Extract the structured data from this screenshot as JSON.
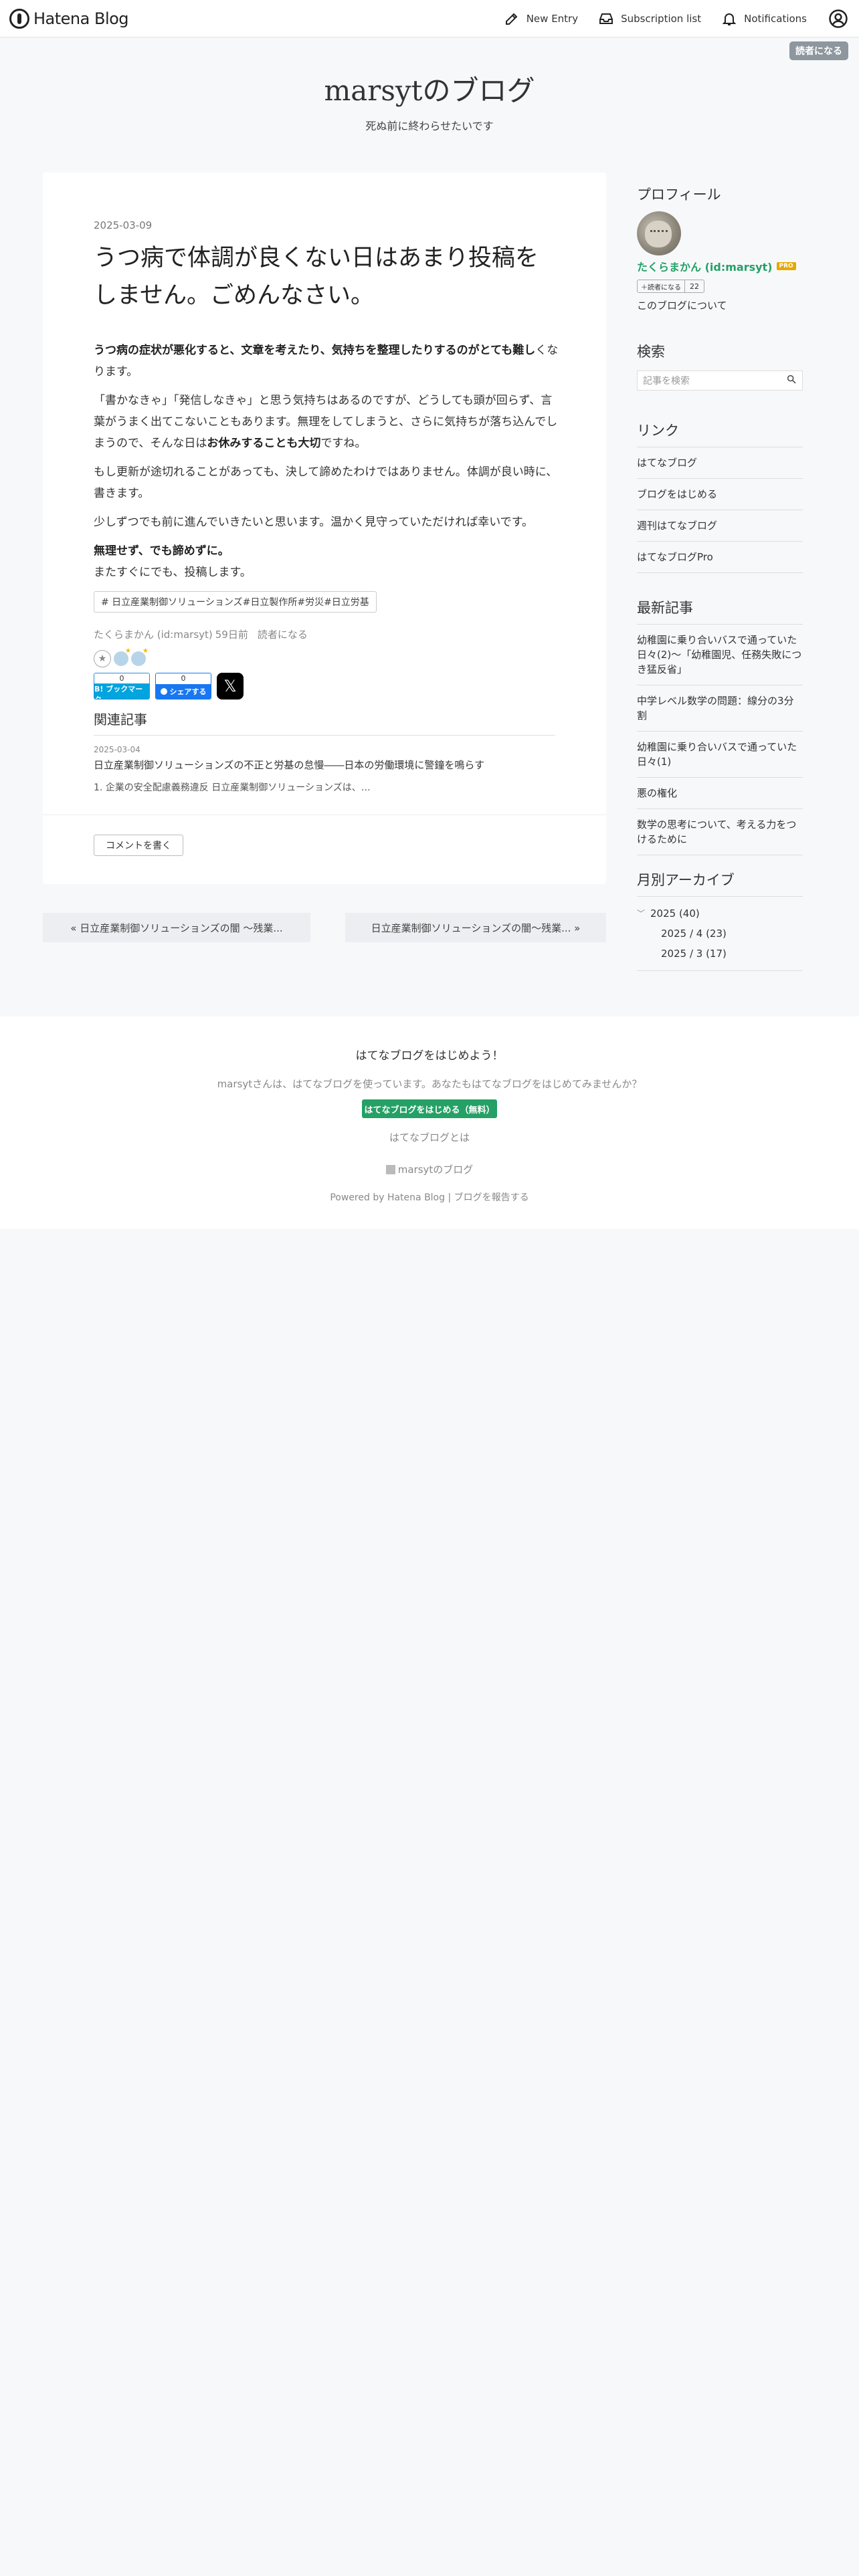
{
  "header": {
    "logo_text": "Hatena Blog",
    "actions": {
      "new_entry": "New Entry",
      "subscription": "Subscription list",
      "notifications": "Notifications"
    }
  },
  "reader_button": "読者になる",
  "blog": {
    "title": "marsytのブログ",
    "description": "死ぬ前に終わらせたいです"
  },
  "entry": {
    "date": "2025-03-09",
    "title": "うつ病で体調が良くない日はあまり投稿をしません。ごめんなさい。",
    "paragraphs": [
      {
        "bold": "うつ病の症状が悪化すると、文章を考えたり、気持ちを整理したりするのがとても難し",
        "text": "くなります。"
      },
      {
        "pre": "「書かなきゃ」「発信しなきゃ」と思う気持ちはあるのですが、どうしても頭が回らず、言葉がうまく出てこないこともあります。無理をしてしまうと、さらに気持ちが落ち込んでしまうので、そんな日は",
        "bold": "お休みすることも大切",
        "post": "ですね。"
      },
      {
        "text": "もし更新が途切れることがあっても、決して諦めたわけではありません。体調が良い時に、書きます。"
      },
      {
        "text": "少しずつでも前に進んでいきたいと思います。温かく見守っていただければ幸いです。"
      },
      {
        "bold": "無理せず、でも諦めずに。",
        "text": "またすぐにでも、投稿します。"
      }
    ],
    "tags": "# 日立産業制御ソリューションズ#日立製作所#労災#日立労基",
    "author": "たくらまかん (id:marsyt)",
    "time_ago": "59日前",
    "reader_link": "読者になる",
    "share": {
      "hatebu_count": "0",
      "hatebu_label": "B! ブックマーク",
      "fb_count": "0",
      "fb_label": "シェアする",
      "x_label": "𝕏"
    },
    "related": {
      "heading": "関連記事",
      "date": "2025-03-04",
      "title": "日立産業制御ソリューションズの不正と労基の怠慢――日本の労働環境に警鐘を鳴らす",
      "excerpt": "1. 企業の安全配慮義務違反 日立産業制御ソリューションズは、…"
    },
    "comment_button": "コメントを書く"
  },
  "pager": {
    "prev": "« 日立産業制御ソリューションズの闇 〜残業...",
    "next": "日立産業制御ソリューションズの闇〜残業... »"
  },
  "sidebar": {
    "profile": {
      "title": "プロフィール",
      "name": "たくらまかん (id:marsyt)",
      "pro_badge": "PRO",
      "reader_label": "＋読者になる",
      "reader_count": "22",
      "about": "このブログについて"
    },
    "search": {
      "title": "検索",
      "placeholder": "記事を検索",
      "icon": "search-icon"
    },
    "links": {
      "title": "リンク",
      "items": [
        "はてなブログ",
        "ブログをはじめる",
        "週刊はてなブログ",
        "はてなブログPro"
      ]
    },
    "recent": {
      "title": "最新記事",
      "items": [
        "幼稚園に乗り合いバスで通っていた日々(2)〜「幼稚園児、任務失敗につき猛反省」",
        "中学レベル数学の問題：線分の3分割",
        "幼稚園に乗り合いバスで通っていた日々(1)",
        "悪の権化",
        "数学の思考について、考える力をつけるために"
      ]
    },
    "archive": {
      "title": "月別アーカイブ",
      "year": "2025 (40)",
      "months": [
        "2025 / 4 (23)",
        "2025 / 3 (17)"
      ]
    }
  },
  "footer": {
    "title": "はてなブログをはじめよう！",
    "text": "marsytさんは、はてなブログを使っています。あなたもはてなブログをはじめてみませんか？",
    "button": "はてなブログをはじめる（無料）",
    "about_link": "はてなブログとは",
    "blog_name": "marsytのブログ",
    "powered": "Powered by Hatena Blog | ブログを報告する"
  }
}
